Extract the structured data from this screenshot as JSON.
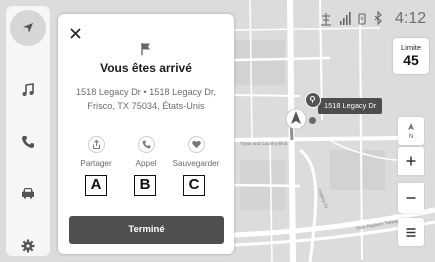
{
  "sidebar": {
    "items": [
      {
        "icon": "navigation-arrow-icon",
        "active": true
      },
      {
        "icon": "music-note-icon",
        "active": false
      },
      {
        "icon": "phone-icon",
        "active": false
      },
      {
        "icon": "car-icon",
        "active": false
      },
      {
        "icon": "gear-icon",
        "active": false
      }
    ]
  },
  "panel": {
    "close_icon": "close-icon",
    "flag_icon": "flag-icon",
    "title": "Vous êtes arrivé",
    "address_line1": "1518 Legacy Dr  •  1518 Legacy Dr,",
    "address_line2": "Frisco, TX 75034, États-Unis",
    "actions": [
      {
        "label": "Partager",
        "icon": "share-icon",
        "marker": "A"
      },
      {
        "label": "Appel",
        "icon": "phone-icon",
        "marker": "B"
      },
      {
        "label": "Sauvegarder",
        "icon": "heart-icon",
        "marker": "C"
      }
    ],
    "done_label": "Terminé"
  },
  "status": {
    "time": "4:12",
    "icons": [
      "antenna-icon",
      "signal-bars-icon",
      "phone-link-icon",
      "bluetooth-icon"
    ]
  },
  "speed_limit": {
    "label": "Limite",
    "value": "45"
  },
  "map": {
    "destination_label": "1518 Legacy Dr",
    "street_labels": [
      "Tryan and Country Blvd",
      "Legacy Dr",
      "Sam Rayburn Tollway"
    ],
    "colors": {
      "road": "#ffffff",
      "background": "#dcdcdc",
      "pin": "#4d4d4d"
    }
  },
  "map_controls": {
    "compass_label": "N",
    "icons": [
      "compass-icon",
      "zoom-in-icon",
      "zoom-out-icon",
      "menu-icon"
    ]
  }
}
